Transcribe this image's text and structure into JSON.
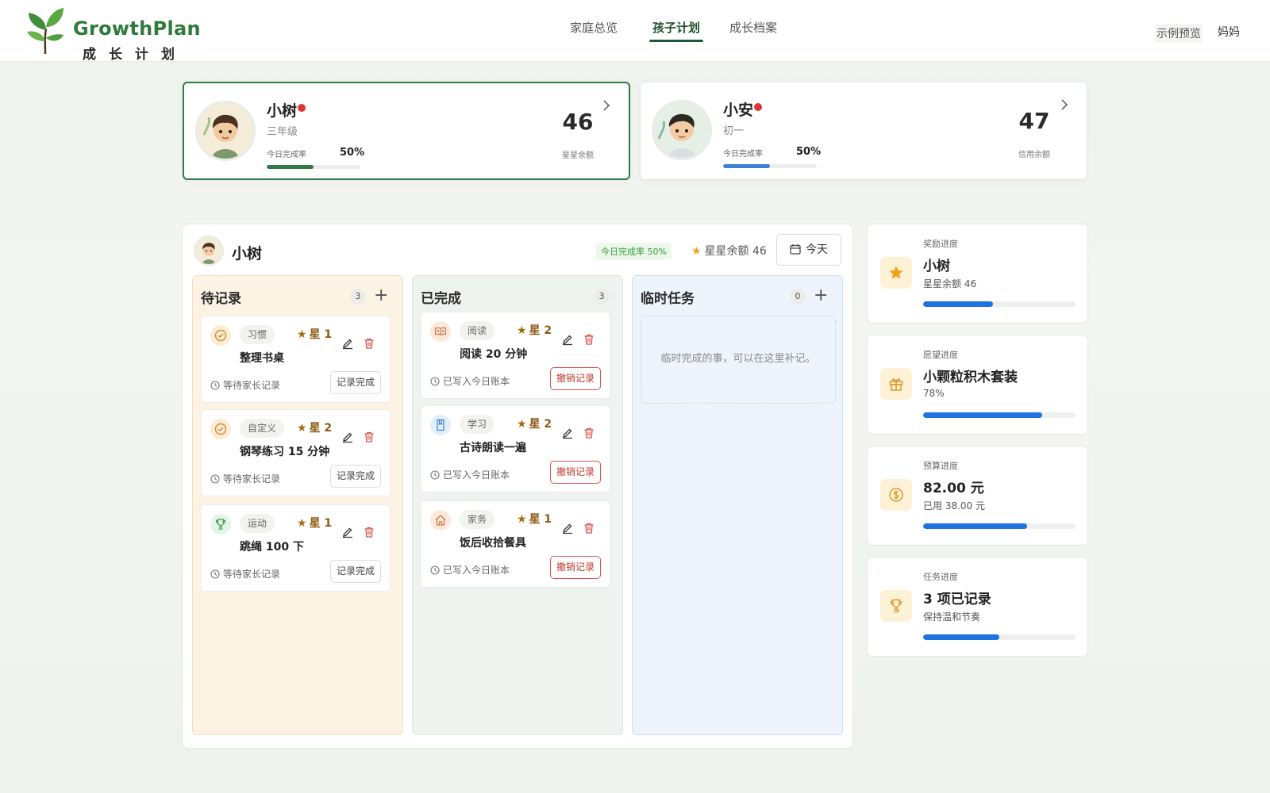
{
  "header": {
    "logo_title": "GrowthPlan",
    "logo_subtitle": "成长计划",
    "nav": [
      {
        "label": "家庭总览",
        "active": false
      },
      {
        "label": "孩子计划",
        "active": true
      },
      {
        "label": "成长档案",
        "active": false
      }
    ],
    "demo_label": "示例预览",
    "user_label": "妈妈"
  },
  "children": [
    {
      "name": "小树",
      "grade": "三年级",
      "rate_label": "今日完成率",
      "rate": "50%",
      "rate_fraction": 0.5,
      "balance": "46",
      "balance_label": "星星余额",
      "bar_color": "#2f7a45",
      "selected": true
    },
    {
      "name": "小安",
      "grade": "初一",
      "rate_label": "今日完成率",
      "rate": "50%",
      "rate_fraction": 0.5,
      "balance": "47",
      "balance_label": "信用余额",
      "bar_color": "#3d82d6",
      "selected": false
    }
  ],
  "board": {
    "child_name": "小树",
    "rate_badge": "今日完成率 50%",
    "star_balance": "星星余额 46",
    "today_label": "今天",
    "columns": {
      "pending": {
        "title": "待记录",
        "count": "3"
      },
      "done": {
        "title": "已完成",
        "count": "3"
      },
      "temp": {
        "title": "临时任务",
        "count": "0",
        "empty_text": "临时完成的事，可以在这里补记。"
      }
    },
    "pending_tasks": [
      {
        "category": "习惯",
        "stars": "星 1",
        "name": "整理书桌",
        "status": "等待家长记录",
        "action": "记录完成",
        "icon": "check-circle-icon"
      },
      {
        "category": "自定义",
        "stars": "星 2",
        "name": "钢琴练习 15 分钟",
        "status": "等待家长记录",
        "action": "记录完成",
        "icon": "check-circle-icon"
      },
      {
        "category": "运动",
        "stars": "星 1",
        "name": "跳绳 100 下",
        "status": "等待家长记录",
        "action": "记录完成",
        "icon": "trophy-icon"
      }
    ],
    "done_tasks": [
      {
        "category": "阅读",
        "stars": "星 2",
        "name": "阅读 20 分钟",
        "status": "已写入今日账本",
        "action": "撤销记录",
        "icon": "book-open-icon"
      },
      {
        "category": "学习",
        "stars": "星 2",
        "name": "古诗朗读一遍",
        "status": "已写入今日账本",
        "action": "撤销记录",
        "icon": "book-icon"
      },
      {
        "category": "家务",
        "stars": "星 1",
        "name": "饭后收拾餐具",
        "status": "已写入今日账本",
        "action": "撤销记录",
        "icon": "home-icon"
      }
    ]
  },
  "progress_cards": [
    {
      "label": "奖励进度",
      "title": "小树",
      "sub": "星星余额 46",
      "fraction": 0.46,
      "icon": "star-icon"
    },
    {
      "label": "愿望进度",
      "title": "小颗粒积木套装",
      "sub": "78%",
      "fraction": 0.78,
      "icon": "gift-icon"
    },
    {
      "label": "预算进度",
      "title": "82.00 元",
      "sub": "已用 38.00 元",
      "fraction": 0.68,
      "icon": "coin-icon"
    },
    {
      "label": "任务进度",
      "title": "3 项已记录",
      "sub": "保持温和节奏",
      "fraction": 0.5,
      "icon": "trophy-icon"
    }
  ]
}
